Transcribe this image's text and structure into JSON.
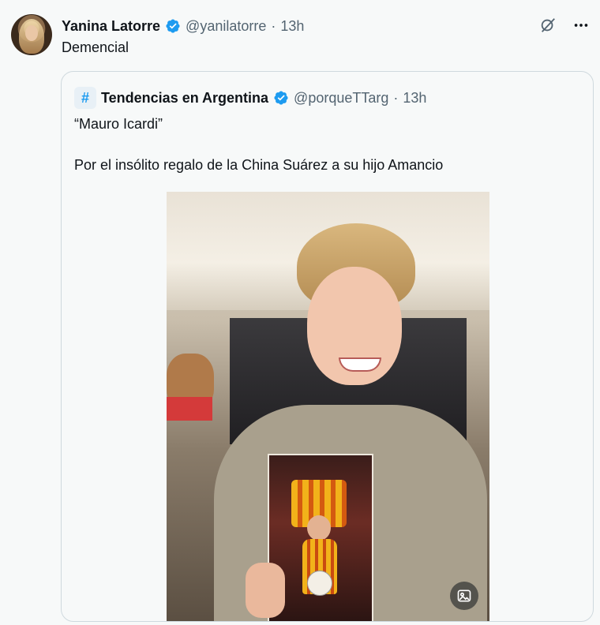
{
  "tweet": {
    "author_name": "Yanina Latorre",
    "author_handle": "@yanilatorre",
    "separator": "·",
    "time": "13h",
    "text": "Demencial",
    "icons": {
      "grok": "grok-icon",
      "more": "more-icon"
    }
  },
  "quote": {
    "author_name": "Tendencias en Argentina",
    "author_handle": "@porqueTTarg",
    "separator": "·",
    "time": "13h",
    "avatar_glyph": "#",
    "line1": "“Mauro Icardi”",
    "line2": "Por el insólito regalo de la China Suárez a su hijo Amancio",
    "media_badge_icon": "image-alt-icon"
  },
  "colors": {
    "verified": "#1d9bf0",
    "muted": "#536471",
    "border": "#cfd9de"
  }
}
